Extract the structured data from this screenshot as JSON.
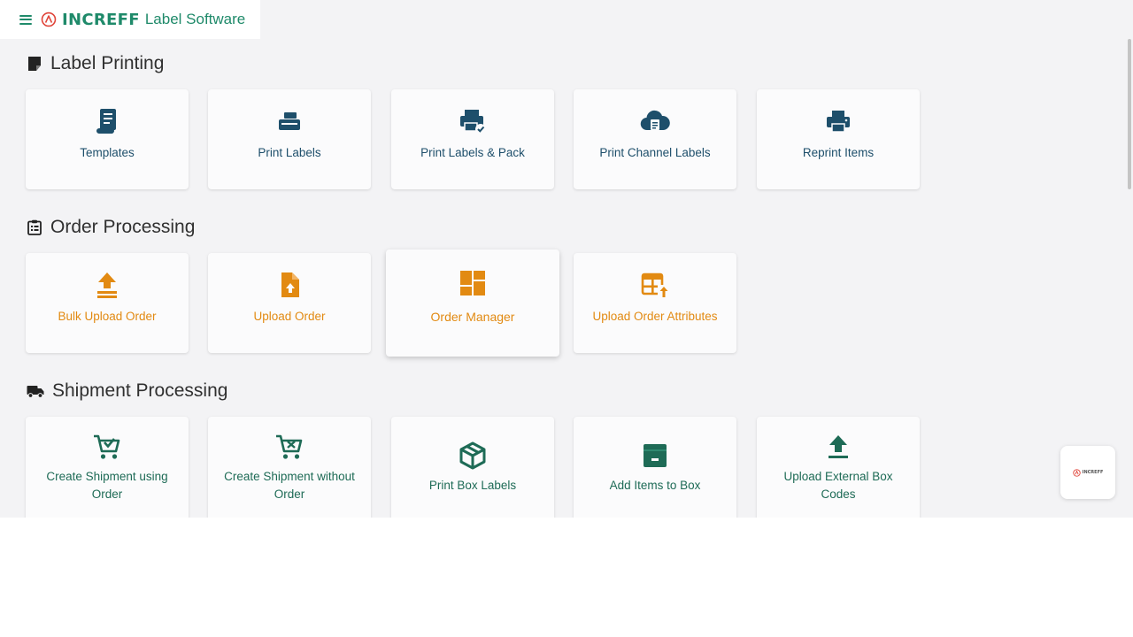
{
  "header": {
    "brand": "INCREFF",
    "app_name": "Label Software",
    "brand_color": "#1f8a6a",
    "logo_accent": "#e0453a"
  },
  "sections": {
    "label_printing": {
      "title": "Label Printing",
      "icon": "sticky-note-icon",
      "accent": "#1e4f6b",
      "cards": [
        {
          "label": "Templates",
          "icon": "scroll-icon"
        },
        {
          "label": "Print Labels",
          "icon": "label-printer-icon"
        },
        {
          "label": "Print Labels & Pack",
          "icon": "printer-check-icon"
        },
        {
          "label": "Print Channel Labels",
          "icon": "cloud-document-icon"
        },
        {
          "label": "Reprint Items",
          "icon": "printer-icon"
        }
      ]
    },
    "order_processing": {
      "title": "Order Processing",
      "icon": "clipboard-list-icon",
      "accent": "#e28a12",
      "cards": [
        {
          "label": "Bulk Upload Order",
          "icon": "bulk-upload-icon"
        },
        {
          "label": "Upload Order",
          "icon": "file-upload-icon"
        },
        {
          "label": "Order Manager",
          "icon": "dashboard-icon"
        },
        {
          "label": "Upload Order Attributes",
          "icon": "table-upload-icon"
        }
      ]
    },
    "shipment_processing": {
      "title": "Shipment Processing",
      "icon": "truck-icon",
      "accent": "#1e6b56",
      "cards": [
        {
          "label": "Create Shipment using Order",
          "icon": "cart-check-icon"
        },
        {
          "label": "Create Shipment without Order",
          "icon": "cart-cross-icon"
        },
        {
          "label": "Print Box Labels",
          "icon": "box-icon"
        },
        {
          "label": "Add Items to Box",
          "icon": "archive-box-icon"
        },
        {
          "label": "Upload External Box Codes",
          "icon": "upload-arrow-icon"
        }
      ]
    }
  },
  "widget": {
    "label": "INCREFF",
    "icon": "increff-logo-icon"
  }
}
